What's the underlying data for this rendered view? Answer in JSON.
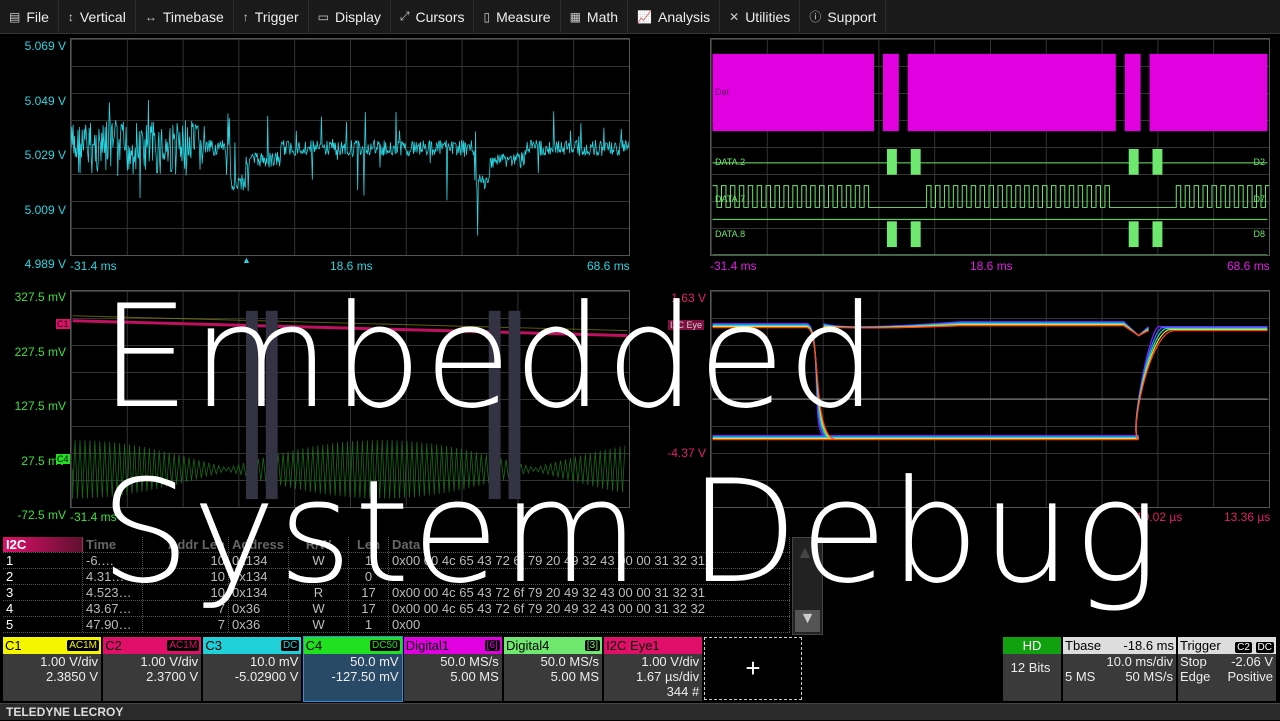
{
  "menu": [
    {
      "label": "File",
      "icon": "clipboard-icon"
    },
    {
      "label": "Vertical",
      "icon": "vertical-arrows-icon"
    },
    {
      "label": "Timebase",
      "icon": "horizontal-arrows-icon"
    },
    {
      "label": "Trigger",
      "icon": "trigger-icon"
    },
    {
      "label": "Display",
      "icon": "display-icon"
    },
    {
      "label": "Cursors",
      "icon": "cursor-icon"
    },
    {
      "label": "Measure",
      "icon": "measure-icon"
    },
    {
      "label": "Math",
      "icon": "calculator-icon"
    },
    {
      "label": "Analysis",
      "icon": "chart-icon"
    },
    {
      "label": "Utilities",
      "icon": "tools-icon"
    },
    {
      "label": "Support",
      "icon": "info-icon"
    }
  ],
  "grid1": {
    "y": [
      "5.069 V",
      "5.049 V",
      "5.029 V",
      "5.009 V",
      "4.989 V"
    ],
    "x": [
      "-31.4 ms",
      "18.6 ms",
      "68.6 ms"
    ],
    "marker": "C3",
    "color": "#2ad4e0"
  },
  "grid2": {
    "labels": [
      "Dat",
      "DATA.2",
      "D2",
      "DATA.7",
      "D7",
      "DATA.8",
      "D8"
    ],
    "x": [
      "-31.4 ms",
      "18.6 ms",
      "68.6 ms"
    ],
    "colors": {
      "bus": "#e000e0",
      "lines": "#6fe86f"
    }
  },
  "grid3": {
    "y": [
      "327.5 mV",
      "227.5 mV",
      "127.5 mV",
      "27.5 mV",
      "-72.5 mV"
    ],
    "x": [
      "-31.4 ms"
    ],
    "markers": [
      "C1",
      "C4"
    ]
  },
  "grid4": {
    "y": [
      "1.63 V",
      "-4.37 V"
    ],
    "x": [
      "10.02 µs",
      "13.36 µs"
    ],
    "marker": "I2C Eye"
  },
  "overlay": {
    "line1": "Embedded",
    "line2": "System Debug"
  },
  "table": {
    "headers": [
      "I2C",
      "Time",
      "Addr Len",
      "Address",
      "R/W",
      "Len",
      "Data"
    ],
    "rows": [
      [
        "1",
        "-6.…",
        "10",
        "0x134",
        "W",
        "1",
        "0x00 00 4c 65 43 72 6f 79 20 49 32 43 00 00 31 32 31"
      ],
      [
        "2",
        "4.31…",
        "10",
        "0x134",
        "",
        "0",
        ""
      ],
      [
        "3",
        "4.523…",
        "10",
        "0x134",
        "R",
        "17",
        "0x00 00 4c 65 43 72 6f 79 20 49 32 43 00 00 31 32 31"
      ],
      [
        "4",
        "43.67…",
        "7",
        "0x36",
        "W",
        "17",
        "0x00 00 4c 65 43 72 6f 79 20 49 32 43 00 00 31 32 32"
      ],
      [
        "5",
        "47.90…",
        "7",
        "0x36",
        "W",
        "1",
        "0x00"
      ]
    ]
  },
  "channels": [
    {
      "name": "C1",
      "badge": "AC1M",
      "l1": "1.00 V/div",
      "l2": "2.3850 V",
      "color": "#f5f500"
    },
    {
      "name": "C2",
      "badge": "AC1M",
      "l1": "1.00 V/div",
      "l2": "2.3700 V",
      "color": "#e0106a"
    },
    {
      "name": "C3",
      "badge": "DC",
      "l1": "10.0 mV",
      "l2": "-5.02900 V",
      "color": "#20d0d8"
    },
    {
      "name": "C4",
      "badge": "DC50",
      "l1": "50.0 mV",
      "l2": "-127.50 mV",
      "color": "#20e020"
    },
    {
      "name": "Digital1",
      "badge": "[6]",
      "l1": "50.0 MS/s",
      "l2": "5.00 MS",
      "color": "#e000e0"
    },
    {
      "name": "Digital4",
      "badge": "[3]",
      "l1": "50.0 MS/s",
      "l2": "5.00 MS",
      "color": "#70e870"
    },
    {
      "name": "I2C Eye1",
      "badge": "",
      "l1": "1.00 V/div",
      "l2": "1.67 µs/div",
      "l3": "344 #",
      "color": "#e0106a"
    }
  ],
  "add_label": "+",
  "hd": {
    "label": "HD",
    "value": "12 Bits"
  },
  "tbase": {
    "label": "Tbase",
    "value": "-18.6 ms",
    "l1": "10.0 ms/div",
    "l2a": "5 MS",
    "l2b": "50 MS/s"
  },
  "trigger": {
    "label": "Trigger",
    "b1": "C2",
    "b2": "DC",
    "a1": "Stop",
    "a2": "-2.06 V",
    "b1v": "Edge",
    "b2v": "Positive"
  },
  "footer": "TELEDYNE LECROY"
}
